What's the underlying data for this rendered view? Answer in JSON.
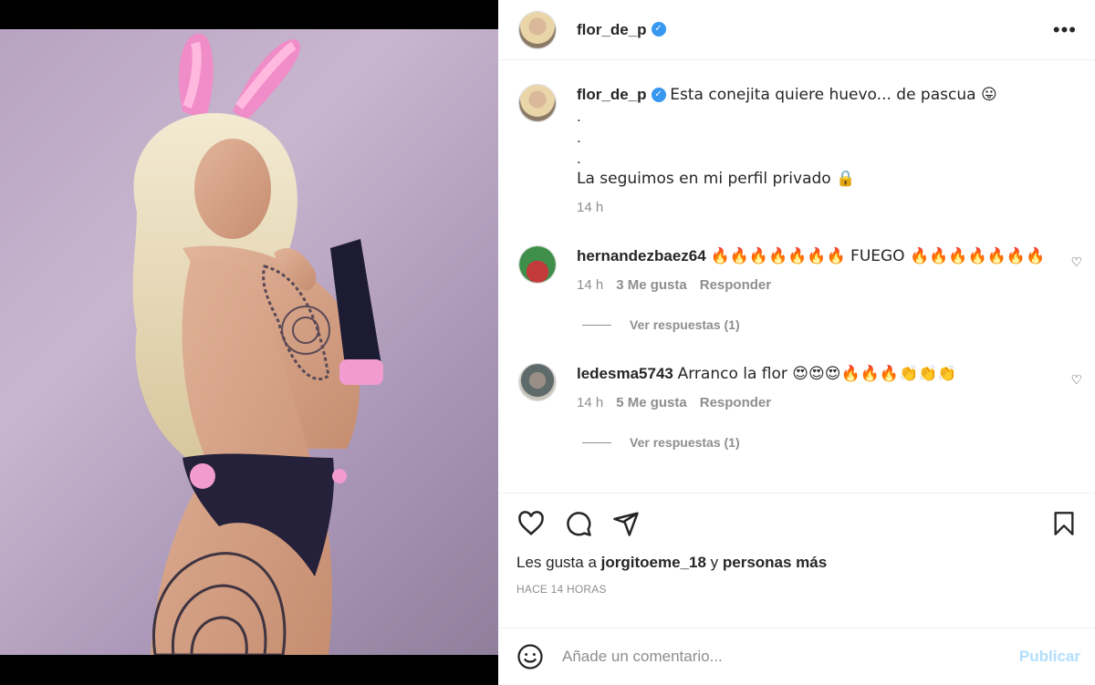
{
  "post": {
    "username": "flor_de_p",
    "caption_lines": [
      "Esta conejita quiere huevo... de pascua 😛",
      ".",
      ".",
      ".",
      "La seguimos en mi perfil privado 🔒"
    ],
    "caption_time": "14 h"
  },
  "comments": [
    {
      "username": "hernandezbaez64",
      "text": "🔥🔥🔥🔥🔥🔥🔥 FUEGO 🔥🔥🔥🔥🔥🔥🔥",
      "time": "14 h",
      "likes": "3 Me gusta",
      "reply": "Responder",
      "view_replies": "Ver respuestas (1)"
    },
    {
      "username": "ledesma5743",
      "text": "Arranco la flor 😍😍😍🔥🔥🔥👏👏👏",
      "time": "14 h",
      "likes": "5 Me gusta",
      "reply": "Responder",
      "view_replies": "Ver respuestas (1)"
    }
  ],
  "likes_line": {
    "prefix": "Les gusta a",
    "user": "jorgitoeme_18",
    "conj": "y",
    "others": "personas más"
  },
  "posted_ago": "HACE 14 HORAS",
  "comment_box": {
    "placeholder": "Añade un comentario...",
    "publish": "Publicar"
  },
  "colors": {
    "verified": "#3897f0",
    "publish_disabled": "#b2dffc",
    "muted": "#8e8e8e"
  },
  "icons": [
    "verified-icon",
    "more-options-icon",
    "heart-icon",
    "comment-icon",
    "share-icon",
    "bookmark-icon",
    "emoji-icon"
  ]
}
